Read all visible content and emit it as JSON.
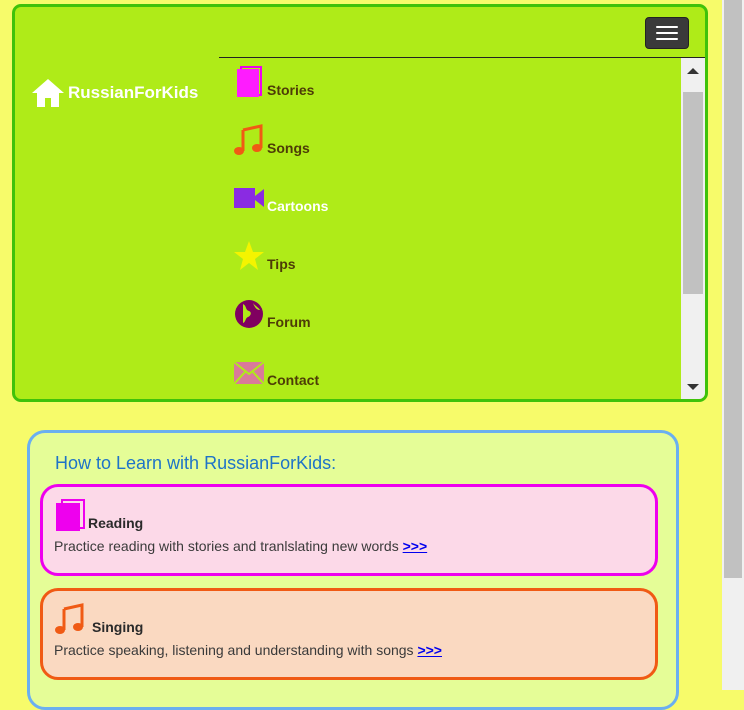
{
  "nav": {
    "brand": "RussianForKids",
    "toggle_label": "menu",
    "items": [
      {
        "label": "Stories",
        "icon": "book-icon",
        "color": "#ee00ee"
      },
      {
        "label": "Songs",
        "icon": "music-note-icon",
        "color": "#f05a14"
      },
      {
        "label": "Cartoons",
        "icon": "video-camera-icon",
        "color": "#8a2be2"
      },
      {
        "label": "Tips",
        "icon": "star-icon",
        "color": "#f4f400"
      },
      {
        "label": "Forum",
        "icon": "globe-icon",
        "color": "#800060"
      },
      {
        "label": "Contact",
        "icon": "envelope-icon",
        "color": "#d97a9a"
      }
    ]
  },
  "learn": {
    "title": "How to Learn with RussianForKids:",
    "cards": [
      {
        "title": "Reading",
        "desc": "Practice reading with stories and tranlslating new words",
        "link": ">>>",
        "icon": "book-icon"
      },
      {
        "title": "Singing",
        "desc": "Practice speaking, listening and understanding with songs",
        "link": ">>>",
        "icon": "music-note-icon"
      }
    ]
  },
  "colors": {
    "page_bg": "#f7fb6a",
    "nav_bg": "#afeb18",
    "nav_border": "#3fc20a",
    "panel_bg": "#e5fd97",
    "panel_border": "#6aaff0"
  }
}
